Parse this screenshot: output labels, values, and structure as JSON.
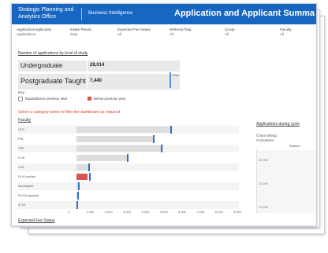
{
  "header": {
    "logo": "Strategic Planning and Analytics Office",
    "section": "Business Intelligence",
    "title": "Application and Applicant Summa"
  },
  "filters": [
    {
      "label": "Application/Applicants",
      "value": "Applications"
    },
    {
      "label": "Intake Period",
      "value": "Sept"
    },
    {
      "label": "Expected Fee Status",
      "value": "All"
    },
    {
      "label": "Deferred Flag",
      "value": "All"
    },
    {
      "label": "Group",
      "value": "All"
    },
    {
      "label": "Faculty",
      "value": "All"
    }
  ],
  "levels": {
    "title": "Number of applications by level of study",
    "rows": [
      {
        "label": "Undergraduate",
        "value": "28,014"
      },
      {
        "label": "Postgraduate Taught",
        "value": "7,440"
      }
    ],
    "marker_label": "Prior"
  },
  "key": {
    "title": "Key",
    "items": [
      {
        "label": "Equal/above previous year",
        "color": "#dcdcdc"
      },
      {
        "label": "Below previous year",
        "color": "#d9534f"
      }
    ]
  },
  "hint": "Select a category below to filter the dashboard as required",
  "faculty": {
    "title": "Faculty",
    "rows": [
      {
        "name": "HLS",
        "value": 5200,
        "prior": 5100,
        "color": "#dddddd"
      },
      {
        "name": "FBL",
        "value": 4200,
        "prior": 4150,
        "color": "#dddddd"
      },
      {
        "name": "FEE",
        "value": 4700,
        "prior": 4600,
        "color": "#dddddd"
      },
      {
        "name": "FLM",
        "value": 2800,
        "prior": 2750,
        "color": "#dddddd"
      },
      {
        "name": "LSS",
        "value": 700,
        "prior": 650,
        "color": "#dddddd"
      },
      {
        "name": "DL/Crossfac",
        "value": 600,
        "prior": 700,
        "color": "#d9534f"
      },
      {
        "name": "Incomplete",
        "value": 100,
        "prior": 80,
        "color": "#dddddd"
      },
      {
        "name": "DL/Geography",
        "value": 80,
        "prior": 60,
        "color": "#dddddd"
      },
      {
        "name": "ICTE",
        "value": 30,
        "prior": 20,
        "color": "#dddddd"
      }
    ],
    "axis_ticks": [
      "0",
      "1,000",
      "2,000",
      "3,000",
      "4,000",
      "5,000",
      "6,000",
      "7,000",
      "8,000",
      "9,000"
    ]
  },
  "right": {
    "title": "Applications during cycle",
    "sub1": "Chart setting:",
    "sub2": "Cumulative",
    "col_label": "Season",
    "y_ticks": [
      "30,000",
      "20,000",
      "10,000"
    ]
  },
  "bottom_title": "Expected Fee Status"
}
